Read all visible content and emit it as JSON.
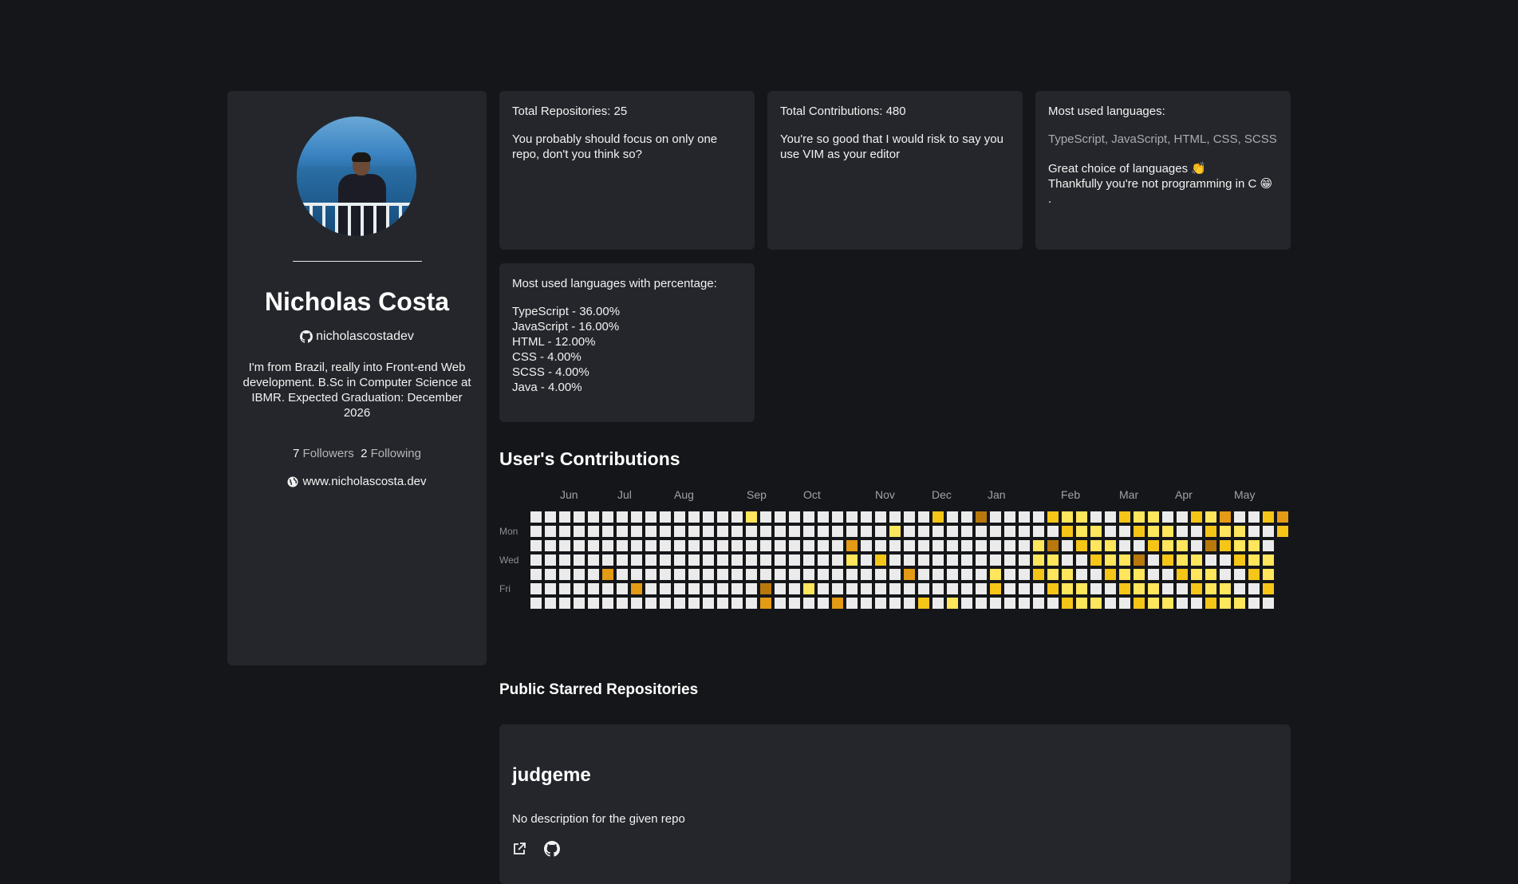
{
  "profile": {
    "name": "Nicholas Costa",
    "username": "nicholascostadev",
    "bio": "I'm from Brazil, really into Front-end Web development. B.Sc in Computer Science at IBMR. Expected Graduation: December 2026",
    "followers_count": "7",
    "followers_label": "Followers",
    "following_count": "2",
    "following_label": "Following",
    "website": "www.nicholascosta.dev"
  },
  "stats": {
    "repos_title": "Total Repositories: 25",
    "repos_text": "You probably should focus on only one repo, don't you think so?",
    "contrib_title": "Total Contributions: 480",
    "contrib_text": "You're so good that I would risk to say you use VIM as your editor",
    "langs_title": "Most used languages:",
    "langs_list": "TypeScript, JavaScript, HTML, CSS, SCSS",
    "langs_comment_1": "Great choice of languages 👏",
    "langs_comment_2": "Thankfully you're not programming in C 😁 .",
    "pct_title": "Most used languages with percentage:",
    "pct_rows": [
      "TypeScript - 36.00%",
      "JavaScript - 16.00%",
      "HTML - 12.00%",
      "CSS - 4.00%",
      "SCSS - 4.00%",
      "Java - 4.00%"
    ]
  },
  "contributions": {
    "title": "User's Contributions",
    "months": [
      "Jun",
      "Jul",
      "Aug",
      "Sep",
      "Oct",
      "Nov",
      "Dec",
      "Jan",
      "Feb",
      "Mar",
      "Apr",
      "May"
    ],
    "days": [
      "Mon",
      "Wed",
      "Fri"
    ],
    "colors": {
      "0": "#ebebeb",
      "1": "#ffe65c",
      "2": "#f5c518",
      "3": "#e39a14",
      "4": "#b8780c"
    }
  },
  "starred": {
    "title": "Public Starred Repositories",
    "repos": [
      {
        "name": "judgeme",
        "description": "No description for the given repo",
        "link_icon": "external-link-icon",
        "github_icon": "github-icon"
      }
    ]
  }
}
